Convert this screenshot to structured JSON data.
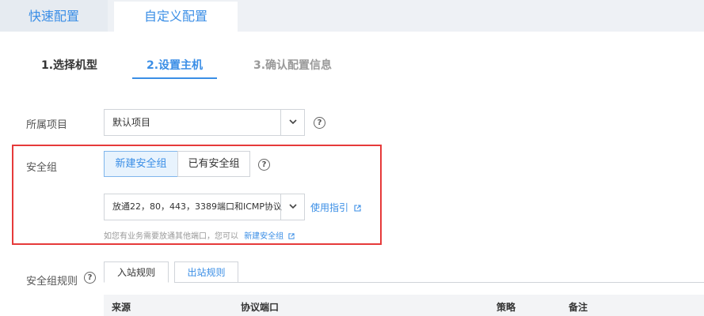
{
  "top_tabs": {
    "quick": "快速配置",
    "custom": "自定义配置"
  },
  "steps": [
    {
      "label": "1.选择机型",
      "state": "done"
    },
    {
      "label": "2.设置主机",
      "state": "active"
    },
    {
      "label": "3.确认配置信息",
      "state": "pending"
    }
  ],
  "project": {
    "label": "所属项目",
    "value": "默认项目"
  },
  "security_group": {
    "label": "安全组",
    "new_button": "新建安全组",
    "existing_button": "已有安全组",
    "selected": "放通22，80，443，3389端口和ICMP协议",
    "guide_link": "使用指引",
    "hint_text": "如您有业务需要放通其他端口，您可以",
    "hint_link": "新建安全组"
  },
  "rules": {
    "label": "安全组规则",
    "tabs": [
      "入站规则",
      "出站规则"
    ],
    "columns": [
      "来源",
      "协议端口",
      "策略",
      "备注"
    ]
  },
  "colors": {
    "accent": "#3a8ee6",
    "highlight": "#e63a3a"
  }
}
